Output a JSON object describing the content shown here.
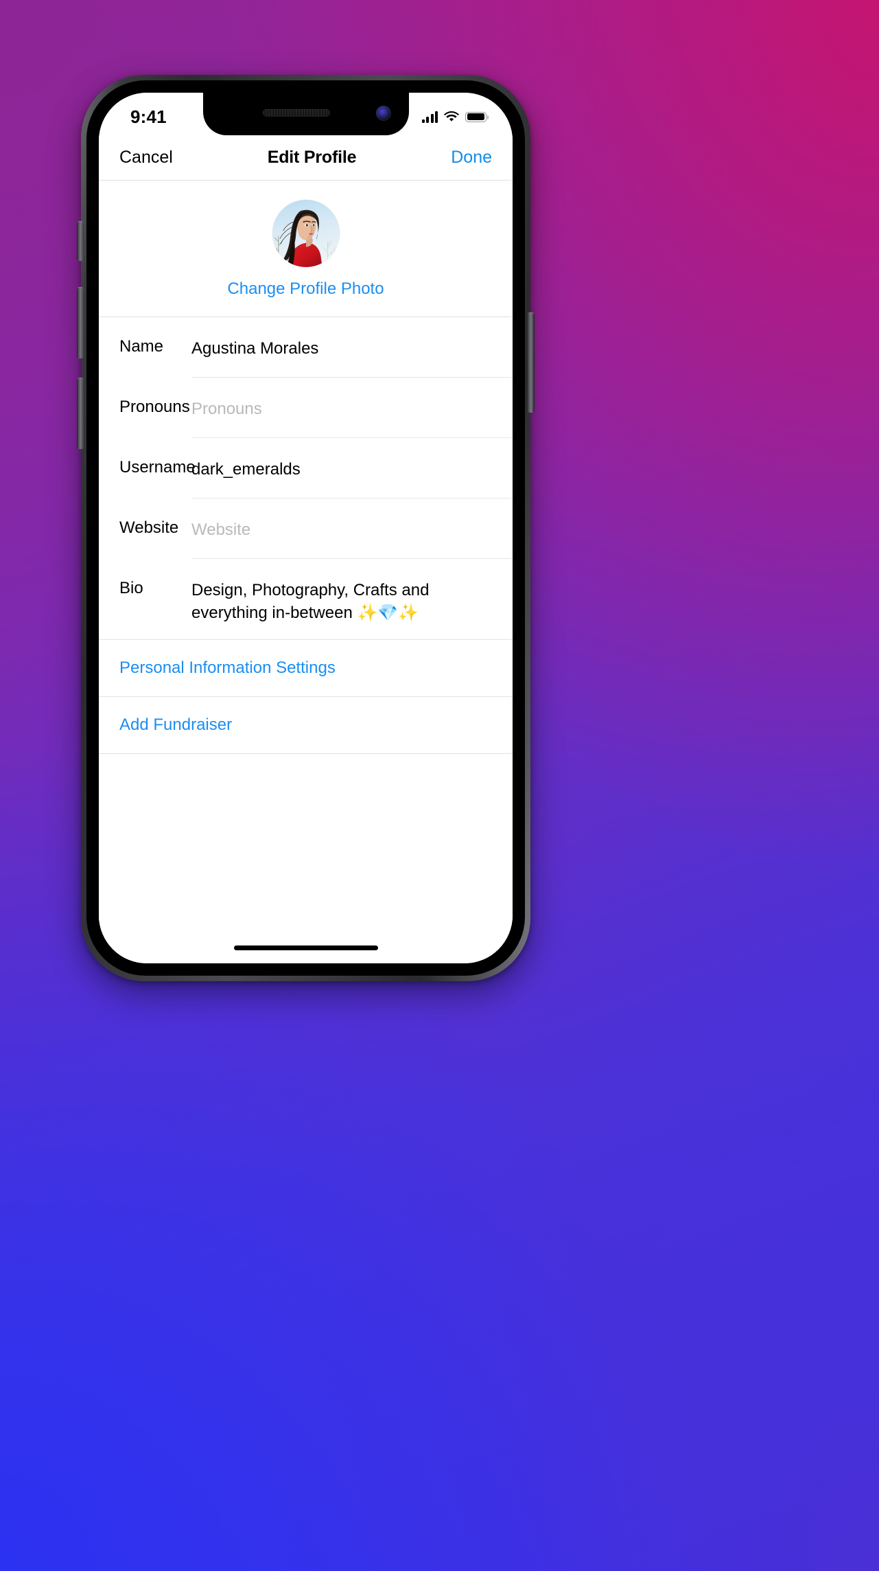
{
  "wallpaper": {
    "corner_top_left": "#8C2596",
    "corner_top_right": "#B21B73",
    "corner_bottom_left": "#2B32F2",
    "corner_bottom_right": "#4A2FD4"
  },
  "status_bar": {
    "time": "9:41",
    "cellular_icon": "signal-bars-icon",
    "wifi_icon": "wifi-icon",
    "battery_icon": "battery-full-icon"
  },
  "navbar": {
    "cancel_label": "Cancel",
    "title": "Edit Profile",
    "done_label": "Done",
    "done_color": "#0f8ded"
  },
  "photo": {
    "avatar_alt": "profile-photo",
    "change_label": "Change Profile Photo",
    "link_color": "#1b8ef2"
  },
  "fields": [
    {
      "label": "Name",
      "value": "Agustina Morales",
      "placeholder": "Name",
      "is_placeholder": false
    },
    {
      "label": "Pronouns",
      "value": "Pronouns",
      "placeholder": "Pronouns",
      "is_placeholder": true
    },
    {
      "label": "Username",
      "value": "dark_emeralds",
      "placeholder": "Username",
      "is_placeholder": false
    },
    {
      "label": "Website",
      "value": "Website",
      "placeholder": "Website",
      "is_placeholder": true
    },
    {
      "label": "Bio",
      "value": "Design, Photography, Crafts and everything in-between ✨💎✨",
      "placeholder": "Bio",
      "is_placeholder": false
    }
  ],
  "links": [
    {
      "label": "Personal Information Settings"
    },
    {
      "label": "Add Fundraiser"
    }
  ],
  "home_indicator": {
    "name": "home-indicator"
  }
}
